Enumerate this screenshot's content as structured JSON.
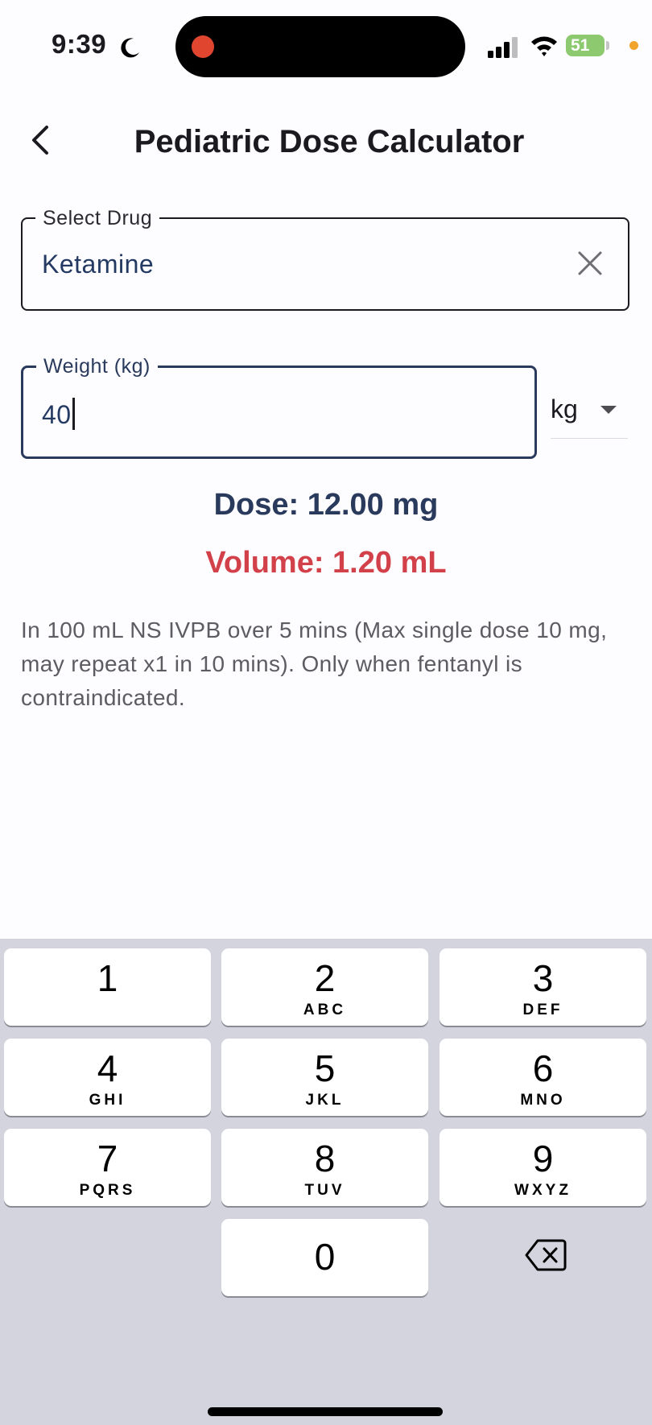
{
  "status_bar": {
    "time": "9:39",
    "battery": "51"
  },
  "app_bar": {
    "title": "Pediatric Dose Calculator"
  },
  "drug_field": {
    "label": "Select Drug",
    "value": "Ketamine"
  },
  "weight_field": {
    "label": "Weight (kg)",
    "value": "40"
  },
  "unit_select": {
    "selected": "kg"
  },
  "results": {
    "dose": "Dose: 12.00 mg",
    "volume": "Volume: 1.20 mL"
  },
  "note": "In 100 mL NS IVPB over 5 mins (Max single dose 10 mg, may repeat x1 in 10 mins). Only when fentanyl is contraindicated.",
  "keypad": {
    "keys": [
      {
        "num": "1",
        "letters": ""
      },
      {
        "num": "2",
        "letters": "ABC"
      },
      {
        "num": "3",
        "letters": "DEF"
      },
      {
        "num": "4",
        "letters": "GHI"
      },
      {
        "num": "5",
        "letters": "JKL"
      },
      {
        "num": "6",
        "letters": "MNO"
      },
      {
        "num": "7",
        "letters": "PQRS"
      },
      {
        "num": "8",
        "letters": "TUV"
      },
      {
        "num": "9",
        "letters": "WXYZ"
      },
      {
        "num": "0",
        "letters": ""
      }
    ]
  },
  "colors": {
    "primary": "#293a5c",
    "volume": "#d2414a",
    "note": "#5c5c61",
    "keyboard_bg": "#d3d4dd"
  },
  "icons": [
    "moon-icon",
    "signal-icon",
    "wifi-icon",
    "battery-icon",
    "back-arrow-icon",
    "clear-icon",
    "dropdown-arrow-icon",
    "backspace-icon"
  ]
}
